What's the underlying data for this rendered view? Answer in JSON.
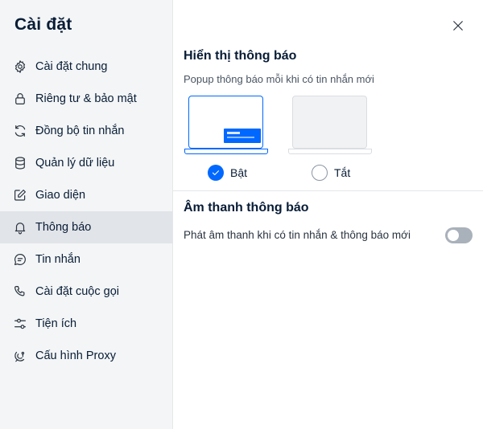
{
  "sidebar": {
    "title": "Cài đặt",
    "items": [
      {
        "label": "Cài đặt chung",
        "icon": "gear-icon",
        "active": false
      },
      {
        "label": "Riêng tư & bảo mật",
        "icon": "lock-icon",
        "active": false
      },
      {
        "label": "Đồng bộ tin nhắn",
        "icon": "sync-icon",
        "active": false
      },
      {
        "label": "Quản lý dữ liệu",
        "icon": "database-icon",
        "active": false
      },
      {
        "label": "Giao diện",
        "icon": "edit-icon",
        "active": false
      },
      {
        "label": "Thông báo",
        "icon": "bell-icon",
        "active": true
      },
      {
        "label": "Tin nhắn",
        "icon": "chat-icon",
        "active": false
      },
      {
        "label": "Cài đặt cuộc gọi",
        "icon": "phone-icon",
        "active": false
      },
      {
        "label": "Tiện ích",
        "icon": "sliders-icon",
        "active": false
      },
      {
        "label": "Cấu hình Proxy",
        "icon": "proxy-icon",
        "active": false
      }
    ]
  },
  "main": {
    "close_icon": "close-icon",
    "display_section": {
      "title": "Hiển thị thông báo",
      "description": "Popup thông báo mỗi khi có tin nhắn mới",
      "options": [
        {
          "label": "Bật",
          "selected": true
        },
        {
          "label": "Tắt",
          "selected": false
        }
      ]
    },
    "sound_section": {
      "title": "Âm thanh thông báo",
      "toggle_label": "Phát âm thanh khi có tin nhắn & thông báo mới",
      "toggle_on": false
    }
  },
  "colors": {
    "accent": "#0068ff",
    "sidebar_bg": "#f3f5f6",
    "active_item_bg": "#e1e4e8",
    "toggle_off": "#a9b1ba",
    "text_primary": "#081c36"
  }
}
